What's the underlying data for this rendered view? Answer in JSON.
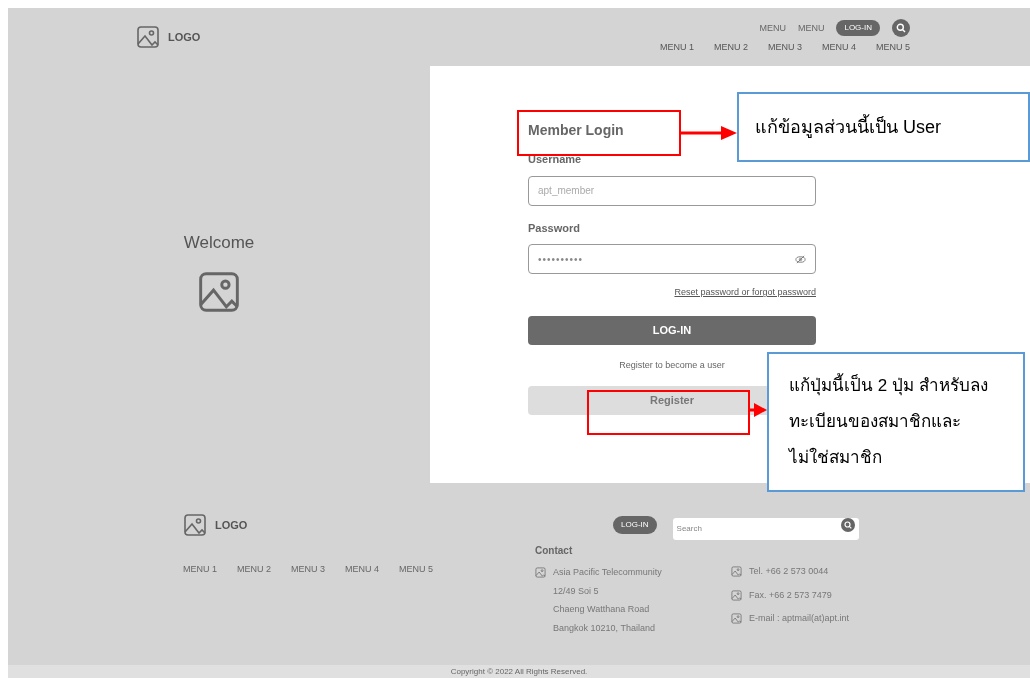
{
  "header": {
    "logo": "LOGO",
    "top_links": [
      "MENU",
      "MENU"
    ],
    "login_button": "LOG-IN",
    "nav": [
      "MENU 1",
      "MENU 2",
      "MENU 3",
      "MENU 4",
      "MENU 5"
    ]
  },
  "welcome": {
    "title": "Welcome"
  },
  "login_form": {
    "title": "Member Login",
    "username_label": "Username",
    "username_placeholder": "apt_member",
    "password_label": "Password",
    "password_value": "••••••••••",
    "forgot_link": "Reset password or forgot password",
    "login_button": "LOG-IN",
    "register_prompt": "Register to become a user",
    "register_button": "Register"
  },
  "annotations": [
    {
      "text": "แก้ข้อมูลส่วนนี้เป็น User"
    },
    {
      "text": "แก้ปุ่มนี้เป็น 2 ปุ่ม สำหรับลงทะเบียนของสมาชิกและไม่ใช่สมาชิก"
    }
  ],
  "footer": {
    "logo": "LOGO",
    "login_button": "LOG-IN",
    "search_placeholder": "Search",
    "nav": [
      "MENU 1",
      "MENU 2",
      "MENU 3",
      "MENU 4",
      "MENU 5"
    ],
    "contact_title": "Contact",
    "address": [
      "Asia Pacific Telecommunity",
      "12/49 Soi 5",
      "Chaeng Watthana Road",
      "Bangkok 10210, Thailand"
    ],
    "contacts": [
      "Tel. +66 2 573 0044",
      "Fax. +66 2 573 7479",
      "E-mail : aptmail(at)apt.int"
    ]
  },
  "copyright": "Copyright © 2022 All Rights Reserved."
}
